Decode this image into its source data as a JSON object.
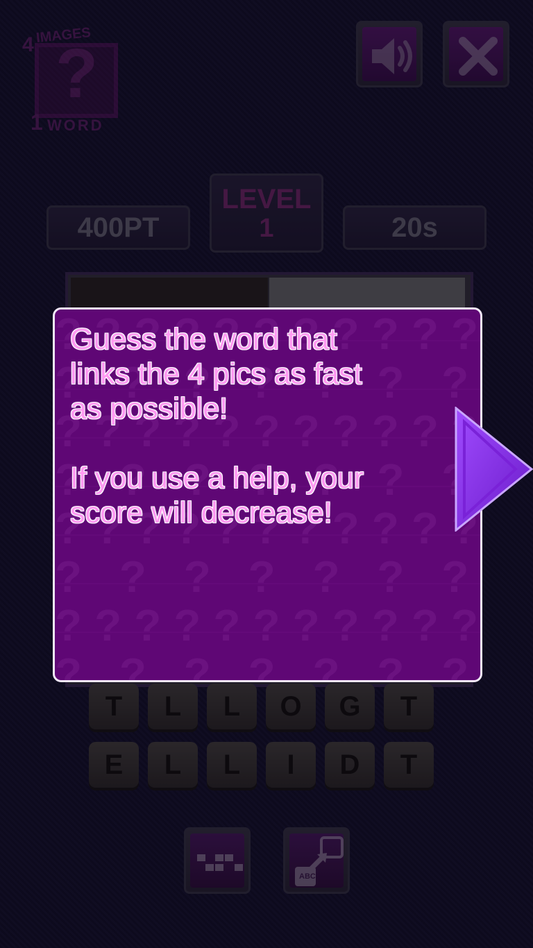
{
  "logo": {
    "number_top": "4",
    "top_text": "IMAGES",
    "symbol": "?",
    "number_bottom": "1",
    "bottom_text": "WORD"
  },
  "header": {
    "sound_icon": "speaker-icon",
    "close_icon": "close-x-icon"
  },
  "stats": {
    "points": "400PT",
    "level_title": "LEVEL",
    "level_number": "1",
    "timer": "20s"
  },
  "letters": {
    "row1": [
      "T",
      "L",
      "L",
      "O",
      "G",
      "T"
    ],
    "row2": [
      "E",
      "L",
      "L",
      "I",
      "D",
      "T"
    ]
  },
  "help_buttons": [
    {
      "icon": "reveal-letters-icon"
    },
    {
      "icon": "swap-letters-icon",
      "label": "ABC"
    }
  ],
  "dialog": {
    "line1": "Guess the word that",
    "line2": "links the 4 pics as fast",
    "line3": "as possible!",
    "line4": "If you use a help, your",
    "line5": "score will decrease!",
    "next_icon": "next-arrow-icon"
  },
  "colors": {
    "dialog_bg": "#5f0775",
    "dialog_text": "#ff9af2",
    "arrow": "#8a2be2",
    "tile": "#3e3a38",
    "background": "#1b1634"
  }
}
